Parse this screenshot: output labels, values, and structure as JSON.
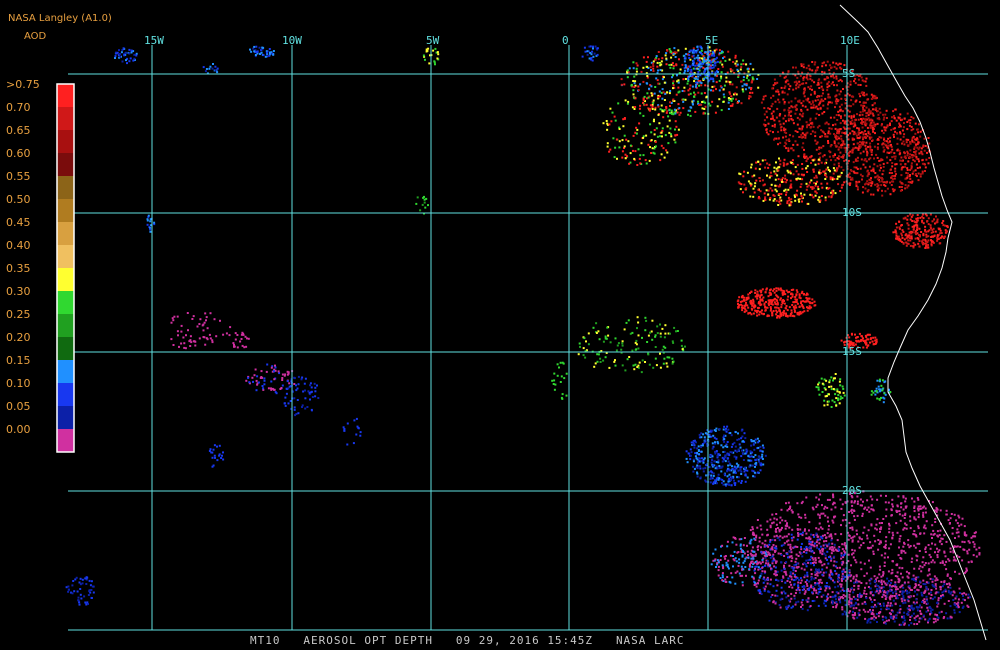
{
  "header": {
    "title": "NASA Langley (A1.0)",
    "variable": "AOD"
  },
  "legend": {
    "labels": [
      ">0.75",
      "0.70",
      "0.65",
      "0.60",
      "0.55",
      "0.50",
      "0.45",
      "0.40",
      "0.35",
      "0.30",
      "0.25",
      "0.20",
      "0.15",
      "0.10",
      "0.05",
      "0.00"
    ],
    "colors": [
      "#ff2020",
      "#d01818",
      "#a81010",
      "#7a0c0c",
      "#8c6418",
      "#b07c20",
      "#d8a040",
      "#f0c060",
      "#ffff30",
      "#30d830",
      "#20a020",
      "#106a10",
      "#2090ff",
      "#1838f0",
      "#0c20a8",
      "#d030a0"
    ]
  },
  "grid": {
    "color": "#60e0e0",
    "lon_labels": [
      "15W",
      "10W",
      "5W",
      "0",
      "5E",
      "10E"
    ],
    "lat_labels": [
      "5S",
      "10S",
      "15S",
      "20S"
    ]
  },
  "caption": {
    "product": "MT10",
    "field": "AEROSOL OPT DEPTH",
    "datetime": "09 29, 2016 15:45Z",
    "source": "NASA LARC"
  }
}
